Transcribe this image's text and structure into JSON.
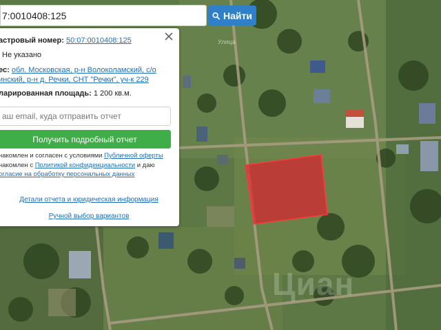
{
  "search": {
    "value": "7:0010408:125",
    "button_label": "Найти"
  },
  "panel": {
    "cadastral": {
      "label": "астровый номер:",
      "value": "50:07:0010408:125"
    },
    "status_value": "Не указано",
    "address": {
      "label": "ес:",
      "line1": "обл. Московская, р-н Волоколамский, с/о",
      "line2": "инский, р-н д. Речки, СНТ \"Речки\", уч-к 229"
    },
    "area": {
      "label": "ларированная площадь:",
      "value": "1 200 кв.м."
    },
    "email_placeholder": "аш email, куда отправить отчет",
    "report_button": "Получить подробный отчет",
    "consent": {
      "line1_text": "накомлен и согласен с условиями",
      "line1_link": "Публичной оферты",
      "line2_text": "накомлен с",
      "line2_link": "Политикой конфиденциальности",
      "line2_tail": "и даю",
      "line3_link": "огласие на обработку персональных данных"
    },
    "details_link": "Детали отчета и юридическая информация",
    "manual_link": "Ручной выбор вариантов"
  },
  "map": {
    "label_road": "Улица",
    "watermark": "Циан"
  },
  "colors": {
    "accent_blue": "#2f80c9",
    "action_green": "#3fae49",
    "parcel_red": "#e8192c"
  }
}
